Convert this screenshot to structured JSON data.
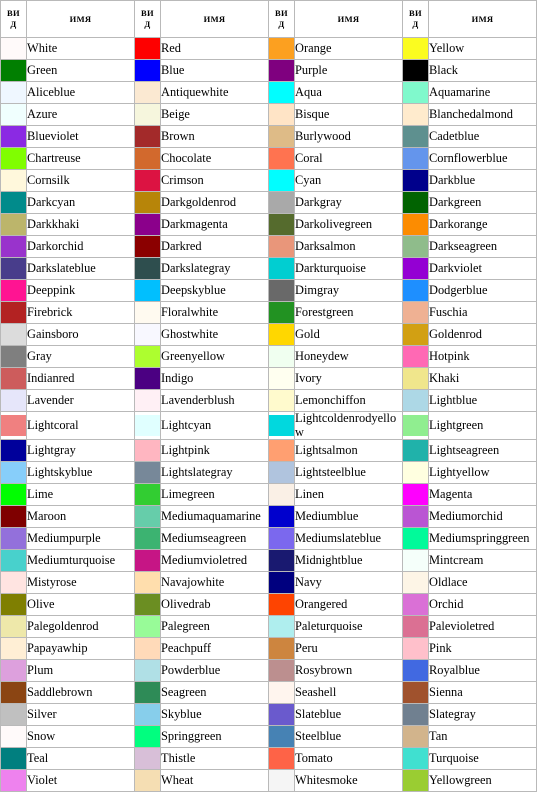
{
  "table": {
    "headers": {
      "swatch_line1": "ВИ",
      "swatch_line2": "Д",
      "name": "ИМЯ"
    },
    "column_groups": 4,
    "rows": [
      [
        {
          "name": "White",
          "color": "#fffafa"
        },
        {
          "name": "Red",
          "color": "#fe0000"
        },
        {
          "name": "Orange",
          "color": "#fca020"
        },
        {
          "name": "Yellow",
          "color": "#fbfc20"
        }
      ],
      [
        {
          "name": "Green",
          "color": "#017f01"
        },
        {
          "name": "Blue",
          "color": "#0000fe"
        },
        {
          "name": "Purple",
          "color": "#7f007f"
        },
        {
          "name": "Black",
          "color": "#000000"
        }
      ],
      [
        {
          "name": "Aliceblue",
          "color": "#eff7ff"
        },
        {
          "name": "Antiquewhite",
          "color": "#fbe9d2"
        },
        {
          "name": "Aqua",
          "color": "#01feff"
        },
        {
          "name": "Aquamarine",
          "color": "#80f9cc"
        }
      ],
      [
        {
          "name": "Azure",
          "color": "#f0fffe"
        },
        {
          "name": "Beige",
          "color": "#f6f6dd"
        },
        {
          "name": "Bisque",
          "color": "#ffe4c6"
        },
        {
          "name": "Blanchedalmond",
          "color": "#ffebcd"
        }
      ],
      [
        {
          "name": "Blueviolet",
          "color": "#8b2ae3"
        },
        {
          "name": "Brown",
          "color": "#a32a2a"
        },
        {
          "name": "Burlywood",
          "color": "#debb87"
        },
        {
          "name": "Cadetblue",
          "color": "#5e908f"
        }
      ],
      [
        {
          "name": "Chartreuse",
          "color": "#80fe01"
        },
        {
          "name": "Chocolate",
          "color": "#d2692d"
        },
        {
          "name": "Coral",
          "color": "#ff7350"
        },
        {
          "name": "Cornflowerblue",
          "color": "#6495ec"
        }
      ],
      [
        {
          "name": "Cornsilk",
          "color": "#fff8dc"
        },
        {
          "name": "Crimson",
          "color": "#dc1342"
        },
        {
          "name": "Cyan",
          "color": "#01feff"
        },
        {
          "name": "Darkblue",
          "color": "#00008b"
        }
      ],
      [
        {
          "name": "Darkcyan",
          "color": "#018b8b"
        },
        {
          "name": "Darkgoldenrod",
          "color": "#b78509"
        },
        {
          "name": "Darkgray",
          "color": "#a9a9a9"
        },
        {
          "name": "Darkgreen",
          "color": "#016301"
        }
      ],
      [
        {
          "name": "Darkkhaki",
          "color": "#bcb56b"
        },
        {
          "name": "Darkmagenta",
          "color": "#8b008b"
        },
        {
          "name": "Darkolivegreen",
          "color": "#556b2d"
        },
        {
          "name": "Darkorange",
          "color": "#fc8c01"
        }
      ],
      [
        {
          "name": "Darkorchid",
          "color": "#9933cc"
        },
        {
          "name": "Darkred",
          "color": "#8b0000"
        },
        {
          "name": "Darksalmon",
          "color": "#e9967a"
        },
        {
          "name": "Darkseagreen",
          "color": "#8fbc8b"
        }
      ],
      [
        {
          "name": "Darkslateblue",
          "color": "#483d8b"
        },
        {
          "name": "Darkslategray",
          "color": "#2e4e4e"
        },
        {
          "name": "Darkturquoise",
          "color": "#01ced1"
        },
        {
          "name": "Darkviolet",
          "color": "#9400d3"
        }
      ],
      [
        {
          "name": "Deeppink",
          "color": "#ff1492"
        },
        {
          "name": "Deepskyblue",
          "color": "#01bffe"
        },
        {
          "name": "Dimgray",
          "color": "#696969"
        },
        {
          "name": "Dodgerblue",
          "color": "#1e8fff"
        }
      ],
      [
        {
          "name": "Firebrick",
          "color": "#b32222"
        },
        {
          "name": "Floralwhite",
          "color": "#fffaf0"
        },
        {
          "name": "Forestgreen",
          "color": "#229222"
        },
        {
          "name": "Fuschia",
          "color": "#efb193"
        }
      ],
      [
        {
          "name": "Gainsboro",
          "color": "#dcdcdc"
        },
        {
          "name": "Ghostwhite",
          "color": "#f8f8ff"
        },
        {
          "name": "Gold",
          "color": "#ffd700"
        },
        {
          "name": "Goldenrod",
          "color": "#d2a013"
        }
      ],
      [
        {
          "name": "Gray",
          "color": "#7f7f7f"
        },
        {
          "name": "Greenyellow",
          "color": "#adfe2f"
        },
        {
          "name": "Honeydew",
          "color": "#f0fff0"
        },
        {
          "name": "Hotpink",
          "color": "#ff69b4"
        }
      ],
      [
        {
          "name": "Indianred",
          "color": "#cd5c5c"
        },
        {
          "name": "Indigo",
          "color": "#4b0082"
        },
        {
          "name": "Ivory",
          "color": "#fffff0"
        },
        {
          "name": "Khaki",
          "color": "#f0e68c"
        }
      ],
      [
        {
          "name": "Lavender",
          "color": "#e6e6fa"
        },
        {
          "name": "Lavenderblush",
          "color": "#fff0f5"
        },
        {
          "name": "Lemonchiffon",
          "color": "#fffacd"
        },
        {
          "name": "Lightblue",
          "color": "#add8e6"
        }
      ],
      [
        {
          "name": "Lightcoral",
          "color": "#f08080"
        },
        {
          "name": "Lightcyan",
          "color": "#e0ffff"
        },
        {
          "name": "Lightcoldenrodyellow",
          "color": "#01d8de"
        },
        {
          "name": "Lightgreen",
          "color": "#90ee90"
        }
      ],
      [
        {
          "name": "Lightgray",
          "color": "#00009b"
        },
        {
          "name": "Lightpink",
          "color": "#ffb6c1"
        },
        {
          "name": "Lightsalmon",
          "color": "#ff9f71"
        },
        {
          "name": "Lightseagreen",
          "color": "#20b2aa"
        }
      ],
      [
        {
          "name": "Lightskyblue",
          "color": "#87cefa"
        },
        {
          "name": "Lightslategray",
          "color": "#778899"
        },
        {
          "name": "Lightsteelblue",
          "color": "#b0c4de"
        },
        {
          "name": "Lightyellow",
          "color": "#ffffe0"
        }
      ],
      [
        {
          "name": "Lime",
          "color": "#01fe01"
        },
        {
          "name": "Limegreen",
          "color": "#32cd32"
        },
        {
          "name": "Linen",
          "color": "#faf0e6"
        },
        {
          "name": "Magenta",
          "color": "#fe01fe"
        }
      ],
      [
        {
          "name": "Maroon",
          "color": "#7f0000"
        },
        {
          "name": "Mediumaquamarine",
          "color": "#66cdaa"
        },
        {
          "name": "Mediumblue",
          "color": "#0000cd"
        },
        {
          "name": "Mediumorchid",
          "color": "#ba55d3"
        }
      ],
      [
        {
          "name": "Mediumpurple",
          "color": "#9370db"
        },
        {
          "name": "Mediumseagreen",
          "color": "#3cb371"
        },
        {
          "name": "Mediumslateblue",
          "color": "#7b68ee"
        },
        {
          "name": "Mediumspringgreen",
          "color": "#01fa9a"
        }
      ],
      [
        {
          "name": "Mediumturquoise",
          "color": "#48d1cc"
        },
        {
          "name": "Mediumvioletred",
          "color": "#c61585"
        },
        {
          "name": "Midnightblue",
          "color": "#191970"
        },
        {
          "name": "Mintcream",
          "color": "#f5fffa"
        }
      ],
      [
        {
          "name": "Mistyrose",
          "color": "#ffe4e1"
        },
        {
          "name": "Navajowhite",
          "color": "#ffdead"
        },
        {
          "name": "Navy",
          "color": "#00007f"
        },
        {
          "name": "Oldlace",
          "color": "#fdf5e6"
        }
      ],
      [
        {
          "name": "Olive",
          "color": "#7f7f01"
        },
        {
          "name": "Olivedrab",
          "color": "#6b8e22"
        },
        {
          "name": "Orangered",
          "color": "#fe4401"
        },
        {
          "name": "Orchid",
          "color": "#da70d6"
        }
      ],
      [
        {
          "name": "Palegoldenrod",
          "color": "#eee8aa"
        },
        {
          "name": "Palegreen",
          "color": "#98fb98"
        },
        {
          "name": "Paleturquoise",
          "color": "#afeeee"
        },
        {
          "name": "Palevioletred",
          "color": "#db7093"
        }
      ],
      [
        {
          "name": "Papayawhip",
          "color": "#ffefd5"
        },
        {
          "name": "Peachpuff",
          "color": "#ffdab9"
        },
        {
          "name": "Peru",
          "color": "#cd853f"
        },
        {
          "name": "Pink",
          "color": "#ffc0cb"
        }
      ],
      [
        {
          "name": "Plum",
          "color": "#dda0dd"
        },
        {
          "name": "Powderblue",
          "color": "#b0e0e6"
        },
        {
          "name": "Rosybrown",
          "color": "#bc8f8f"
        },
        {
          "name": "Royalblue",
          "color": "#4169e1"
        }
      ],
      [
        {
          "name": "Saddlebrown",
          "color": "#8b4513"
        },
        {
          "name": "Seagreen",
          "color": "#2e8b57"
        },
        {
          "name": "Seashell",
          "color": "#fff5ee"
        },
        {
          "name": "Sienna",
          "color": "#a0522d"
        }
      ],
      [
        {
          "name": "Silver",
          "color": "#c0c0c0"
        },
        {
          "name": "Skyblue",
          "color": "#87ceeb"
        },
        {
          "name": "Slateblue",
          "color": "#6a5acd"
        },
        {
          "name": "Slategray",
          "color": "#708090"
        }
      ],
      [
        {
          "name": "Snow",
          "color": "#fffafa"
        },
        {
          "name": "Springgreen",
          "color": "#01fe7f"
        },
        {
          "name": "Steelblue",
          "color": "#4682b4"
        },
        {
          "name": "Tan",
          "color": "#d2b48c"
        }
      ],
      [
        {
          "name": "Teal",
          "color": "#017f7f"
        },
        {
          "name": "Thistle",
          "color": "#d8bfd8"
        },
        {
          "name": "Tomato",
          "color": "#fe6347"
        },
        {
          "name": "Turquoise",
          "color": "#40e0d0"
        }
      ],
      [
        {
          "name": "Violet",
          "color": "#ee82ee"
        },
        {
          "name": "Wheat",
          "color": "#f5deb3"
        },
        {
          "name": "Whitesmoke",
          "color": "#f5f5f5"
        },
        {
          "name": "Yellowgreen",
          "color": "#9acd32"
        }
      ]
    ]
  },
  "style": {
    "border_color": "#b9b9b9",
    "background": "#ffffff",
    "text_color": "#000000"
  }
}
